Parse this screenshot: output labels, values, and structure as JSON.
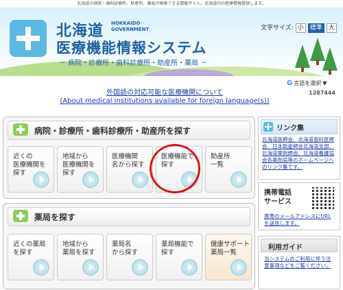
{
  "header": {
    "top_line": "北海道の病院・歯科診療所、助産所、薬局が検索できる情報サイト。北海道内の医療情報提供します。",
    "title_line1": "北海道",
    "gov_line1": "HOKKAIDO",
    "gov_line2": "GOVERNMENT",
    "title_line2": "医療機能情報システム",
    "subtitle": "－ 病院・診療所・歯科診療所・助産所・薬局 －",
    "font_size_label": "文字サイズ:",
    "font_sizes": [
      "小",
      "標準",
      "大"
    ],
    "selected_font_size": "標準",
    "translate_label": "言語を選択",
    "counter": "1287444"
  },
  "foreign_link": {
    "line1": "外国語の対応可能な医療機関について",
    "line2": "(About medical institutions available for foreign language(s))"
  },
  "section_hospital": {
    "title": "病院・診療所・歯科診療所・助産所を探す",
    "buttons": [
      {
        "label": "近くの\n医療機関を\n探す"
      },
      {
        "label": "地域から\n医療機関を\n探す"
      },
      {
        "label": "医療機関\n名から探す"
      },
      {
        "label": "医療機能で\n探す"
      },
      {
        "label": "助産所\n一覧"
      }
    ]
  },
  "section_pharmacy": {
    "title": "薬局を探す",
    "buttons": [
      {
        "label": "近くの薬局\nを探す"
      },
      {
        "label": "地域から\n薬局を探す"
      },
      {
        "label": "薬局名\nから探す"
      },
      {
        "label": "薬局機能で\n探す"
      },
      {
        "label": "健康サポート\n薬局一覧"
      }
    ]
  },
  "sidebar": {
    "links_title": "リンク集",
    "links_text": "北海道医師会、北海道歯科医師会、日本助産師会北海道支部、北海道薬剤師会、北海道看護協会各薬剤局等のホームページへのリンク集です。",
    "mobile_title": "携帯電話\nサービス",
    "mobile_text": "携帯のメールアドレスにURLを送信します。",
    "guide_title": "利用ガイド",
    "guide_text": "当システムのご利用に伴う注意事項などをご覧ください。"
  },
  "colors": {
    "brand_blue": "#2060a8",
    "link_blue": "#1a3aa8",
    "green_plus": "#8fcb5a",
    "highlight_red": "#e01010"
  }
}
